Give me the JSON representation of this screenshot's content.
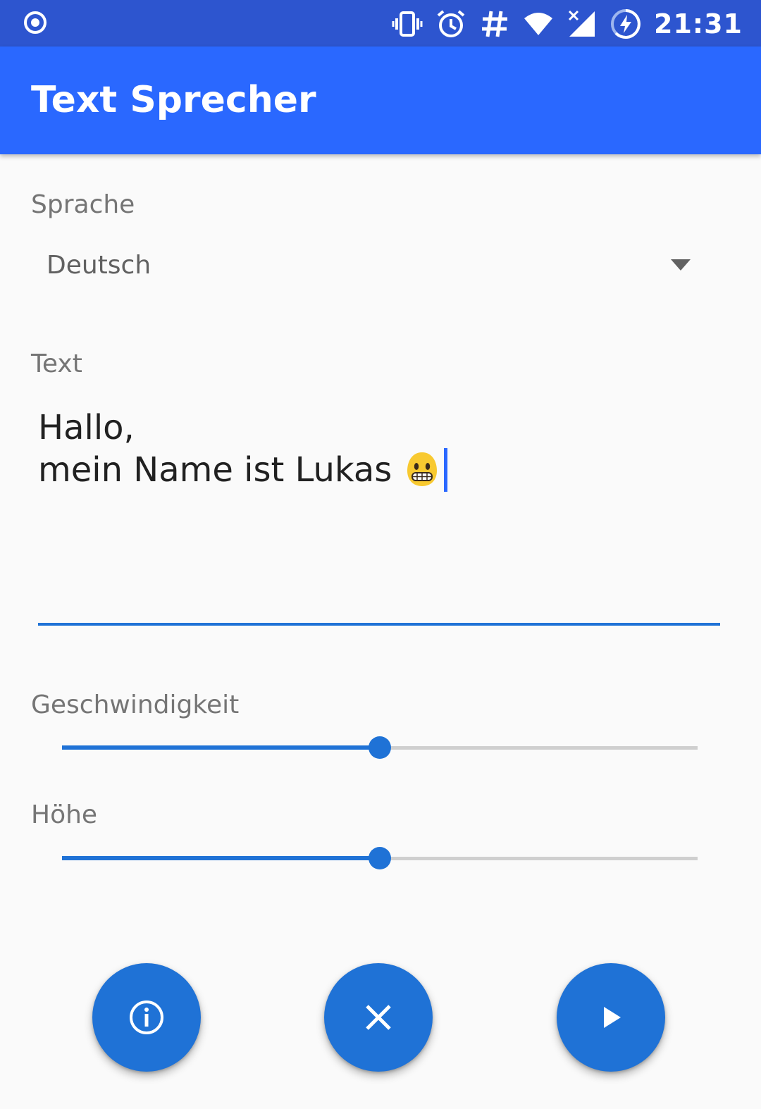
{
  "status_bar": {
    "time": "21:31",
    "icons": [
      "record-icon",
      "vibrate-icon",
      "alarm-icon",
      "hash-icon",
      "wifi-icon",
      "cell-signal-off-icon",
      "battery-charging-icon"
    ]
  },
  "app_bar": {
    "title": "Text Sprecher"
  },
  "language": {
    "label": "Sprache",
    "selected": "Deutsch"
  },
  "text_input": {
    "label": "Text",
    "line1": "Hallo,",
    "line2": "mein Name ist Lukas",
    "emoji": "grinning-face-emoji"
  },
  "speed": {
    "label": "Geschwindigkeit",
    "value_fraction": 0.5
  },
  "pitch": {
    "label": "Höhe",
    "value_fraction": 0.5
  },
  "actions": {
    "icons": [
      "info-icon",
      "close-icon",
      "play-icon"
    ]
  },
  "colors": {
    "status_bar": "#2d55cf",
    "app_bar": "#2a68ff",
    "accent": "#1f72d6",
    "background": "#fafafa"
  }
}
